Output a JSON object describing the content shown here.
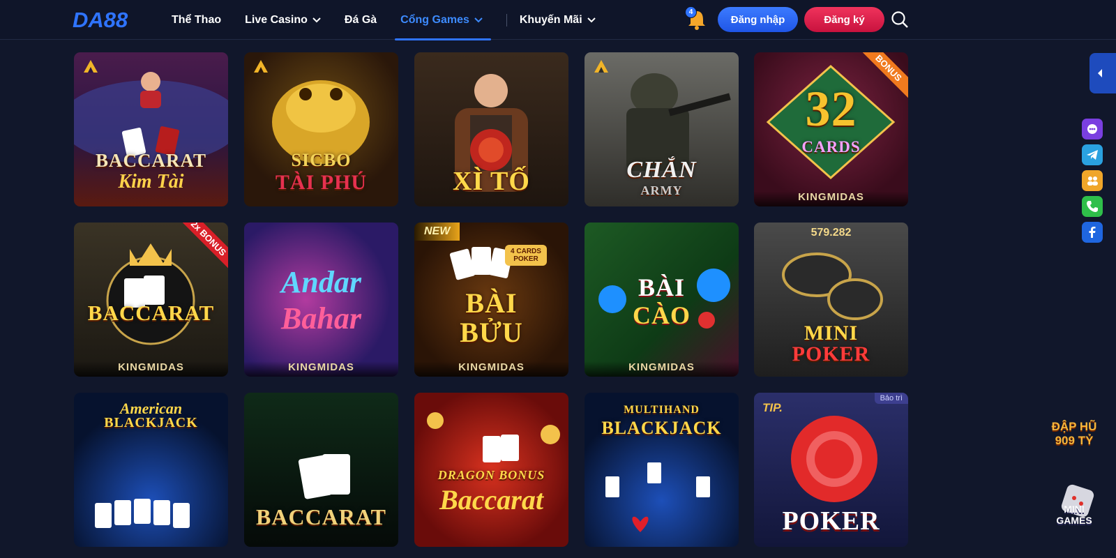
{
  "brand": {
    "logo_text": "DA88"
  },
  "nav": {
    "items": [
      {
        "label": "Thể Thao",
        "has_dropdown": false,
        "active": false
      },
      {
        "label": "Live Casino",
        "has_dropdown": true,
        "active": false
      },
      {
        "label": "Đá Gà",
        "has_dropdown": false,
        "active": false
      },
      {
        "label": "Cổng Games",
        "has_dropdown": true,
        "active": true
      },
      {
        "label": "Khuyến Mãi",
        "has_dropdown": true,
        "active": false
      }
    ]
  },
  "header": {
    "notification_count": "4",
    "login_label": "Đăng nhập",
    "register_label": "Đăng ký"
  },
  "games": [
    {
      "title": "BACCARAT",
      "subtitle": "Kim Tài",
      "provider": "",
      "badge": ""
    },
    {
      "title": "SICBO",
      "subtitle": "TÀI PHÚ",
      "provider": "",
      "badge": ""
    },
    {
      "title": "XÌ TỐ",
      "subtitle": "",
      "provider": "",
      "badge": ""
    },
    {
      "title": "CHẮN",
      "subtitle": "ARMY",
      "provider": "",
      "badge": ""
    },
    {
      "title": "32",
      "subtitle": "CARDS",
      "provider": "KINGMIDAS",
      "badge": "BONUS"
    },
    {
      "title": "BACCARAT",
      "subtitle": "",
      "provider": "KINGMIDAS",
      "badge": "2x BONUS"
    },
    {
      "title": "Andar",
      "subtitle": "Bahar",
      "provider": "KINGMIDAS",
      "badge": ""
    },
    {
      "title": "BÀI",
      "subtitle": "BỬU",
      "provider": "KINGMIDAS",
      "badge": "NEW",
      "extra": "4 CARDS POKER"
    },
    {
      "title": "BÀI",
      "subtitle": "CÀO",
      "provider": "KINGMIDAS",
      "badge": ""
    },
    {
      "title": "MINI",
      "subtitle": "POKER",
      "provider": "",
      "badge": "",
      "jackpot": "579.282"
    },
    {
      "title": "American",
      "subtitle": "BLACKJACK",
      "provider": "",
      "badge": ""
    },
    {
      "title": "BACCARAT",
      "subtitle": "",
      "provider": "",
      "badge": ""
    },
    {
      "title": "DRAGON BONUS",
      "subtitle": "Baccarat",
      "provider": "",
      "badge": ""
    },
    {
      "title": "MULTIHAND",
      "subtitle": "BLACKJACK",
      "provider": "",
      "badge": ""
    },
    {
      "title": "POKER",
      "subtitle": "TIP.",
      "provider": "",
      "badge": "Bảo trì"
    }
  ],
  "side": {
    "promo_text": "ĐẬP HŨ 909 TỶ",
    "mini_games": "MINI GAMES"
  },
  "colors": {
    "background": "#11172b",
    "accent": "#2f74ff",
    "register": "#e0244b",
    "gold": "#f3c24b"
  }
}
